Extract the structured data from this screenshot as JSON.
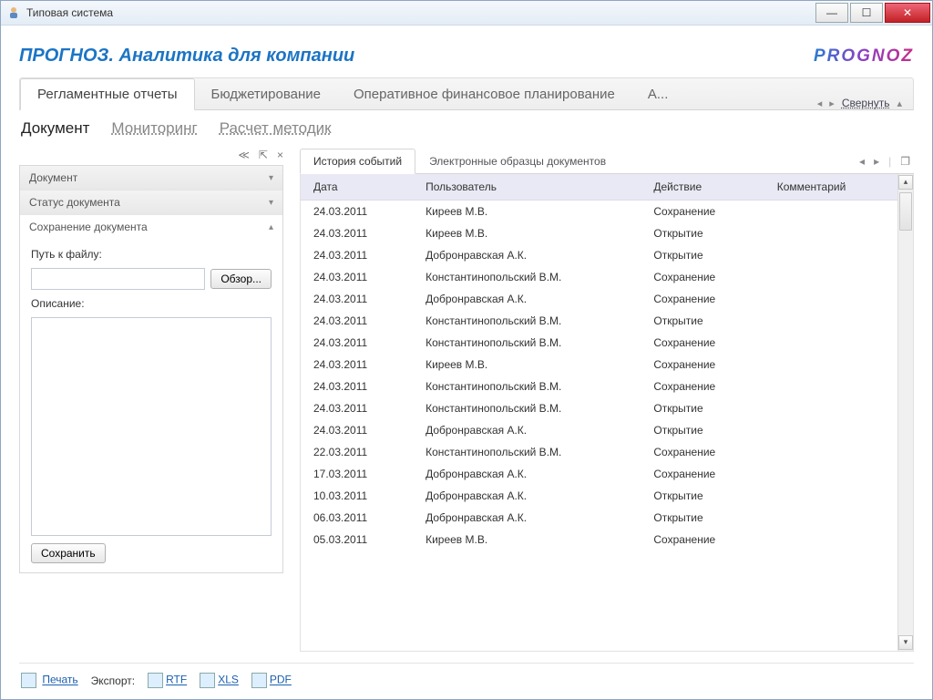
{
  "window": {
    "title": "Типовая система"
  },
  "header": {
    "title": "ПРОГНОЗ. Аналитика для компании",
    "brand": "PROGNOZ"
  },
  "maintabs": {
    "items": [
      "Регламентные отчеты",
      "Бюджетирование",
      "Оперативное финансовое планирование",
      "А..."
    ],
    "collapse": "Свернуть"
  },
  "subtabs": {
    "items": [
      "Документ",
      "Мониторинг",
      "Расчет методик"
    ]
  },
  "left": {
    "tool_back": "≪",
    "tool_pin": "⇱",
    "tool_close": "×",
    "sections": {
      "doc": "Документ",
      "status": "Статус документа",
      "save": "Сохранение документа"
    },
    "path_label": "Путь к файлу:",
    "path_value": "",
    "browse": "Обзор...",
    "desc_label": "Описание:",
    "desc_value": "",
    "save_btn": "Сохранить"
  },
  "innertabs": {
    "items": [
      "История событий",
      "Электронные образцы документов"
    ]
  },
  "grid": {
    "columns": [
      "Дата",
      "Пользователь",
      "Действие",
      "Комментарий"
    ],
    "rows": [
      {
        "d": "24.03.2011",
        "u": "Киреев М.В.",
        "a": "Сохранение",
        "c": ""
      },
      {
        "d": "24.03.2011",
        "u": "Киреев М.В.",
        "a": "Открытие",
        "c": ""
      },
      {
        "d": "24.03.2011",
        "u": "Добронравская А.К.",
        "a": "Открытие",
        "c": ""
      },
      {
        "d": "24.03.2011",
        "u": "Константинопольский В.М.",
        "a": "Сохранение",
        "c": ""
      },
      {
        "d": "24.03.2011",
        "u": "Добронравская А.К.",
        "a": "Сохранение",
        "c": ""
      },
      {
        "d": "24.03.2011",
        "u": "Константинопольский В.М.",
        "a": "Открытие",
        "c": ""
      },
      {
        "d": "24.03.2011",
        "u": "Константинопольский В.М.",
        "a": "Сохранение",
        "c": ""
      },
      {
        "d": "24.03.2011",
        "u": "Киреев М.В.",
        "a": "Сохранение",
        "c": ""
      },
      {
        "d": "24.03.2011",
        "u": "Константинопольский В.М.",
        "a": "Сохранение",
        "c": ""
      },
      {
        "d": "24.03.2011",
        "u": "Константинопольский В.М.",
        "a": "Открытие",
        "c": ""
      },
      {
        "d": "24.03.2011",
        "u": "Добронравская А.К.",
        "a": "Открытие",
        "c": ""
      },
      {
        "d": "22.03.2011",
        "u": "Константинопольский В.М.",
        "a": "Сохранение",
        "c": ""
      },
      {
        "d": "17.03.2011",
        "u": "Добронравская А.К.",
        "a": "Сохранение",
        "c": ""
      },
      {
        "d": "10.03.2011",
        "u": "Добронравская А.К.",
        "a": "Открытие",
        "c": ""
      },
      {
        "d": "06.03.2011",
        "u": "Добронравская А.К.",
        "a": "Открытие",
        "c": ""
      },
      {
        "d": "05.03.2011",
        "u": "Киреев М.В.",
        "a": "Сохранение",
        "c": ""
      }
    ]
  },
  "footer": {
    "print": "Печать",
    "export_label": "Экспорт:",
    "rtf": "RTF",
    "xls": "XLS",
    "pdf": "PDF"
  }
}
